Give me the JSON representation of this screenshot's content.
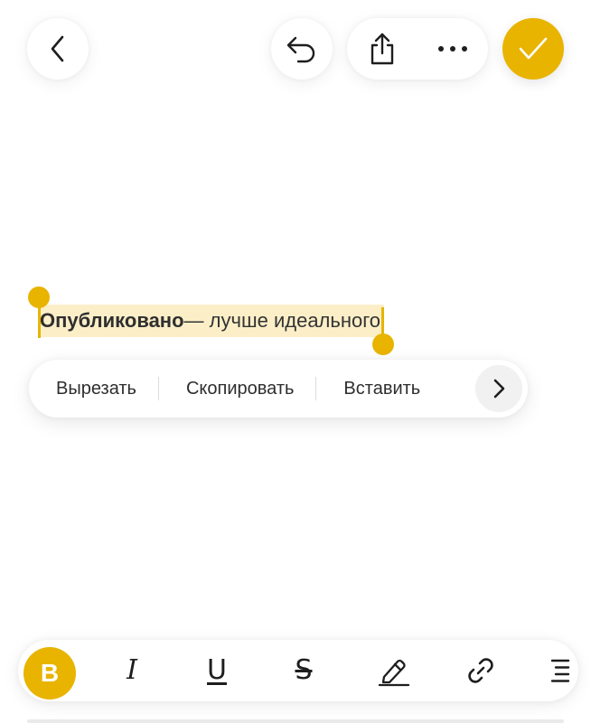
{
  "colors": {
    "accent": "#e8b400",
    "selection": "#fcefc8",
    "icon": "#1e1e1e"
  },
  "topbar": {
    "back_icon": "chevron-left-icon",
    "undo_icon": "undo-icon",
    "share_icon": "share-icon",
    "more_icon": "more-horizontal-icon",
    "done_icon": "checkmark-icon"
  },
  "editor": {
    "bold_text": "Опубликовано",
    "rest_text": " — лучше идеального"
  },
  "context_menu": {
    "items": [
      "Вырезать",
      "Скопировать",
      "Вставить"
    ],
    "more_icon": "chevron-right-icon"
  },
  "format_toolbar": {
    "bold_label": "B",
    "italic_label": "I",
    "underline_label": "U",
    "strike_label": "S",
    "highlight_icon": "highlighter-icon",
    "link_icon": "link-icon",
    "list_icon": "list-icon"
  }
}
